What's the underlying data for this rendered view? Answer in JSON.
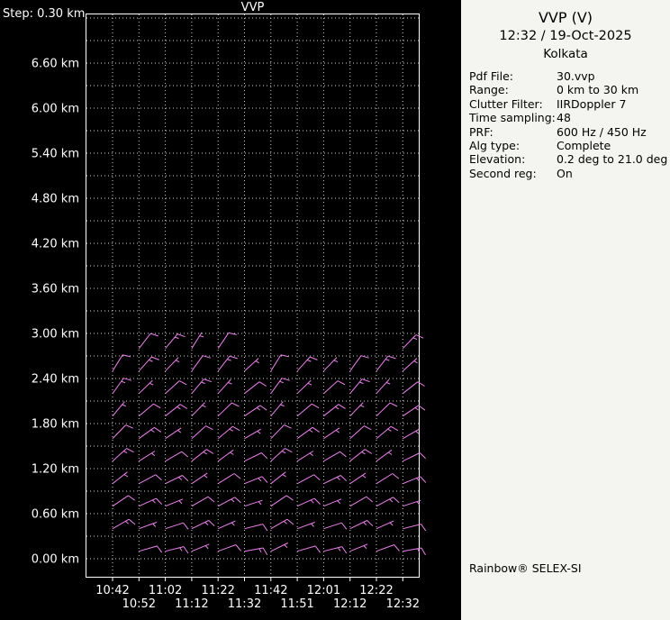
{
  "colors": {
    "background": "#000000",
    "panel_background": "#f4f4f0",
    "frame": "#ffffff",
    "grid": "#d0d0d0",
    "axis_text": "#ffffff",
    "barb": "#ee82ee",
    "panel_text": "#000000"
  },
  "chart": {
    "title": "VVP",
    "step_label": "Step: 0.30 km"
  },
  "info_panel": {
    "title": "VVP (V)",
    "datetime": "12:32 / 19-Oct-2025",
    "site": "Kolkata",
    "fields": [
      {
        "label": "Pdf File:",
        "value": "30.vvp"
      },
      {
        "label": "Range:",
        "value": "0 km to 30 km"
      },
      {
        "label": "Clutter Filter:",
        "value": "IIRDoppler 7"
      },
      {
        "label": "Time sampling:",
        "value": "48"
      },
      {
        "label": "PRF:",
        "value": "600 Hz / 450 Hz"
      },
      {
        "label": "Alg type:",
        "value": "Complete"
      },
      {
        "label": "Elevation:",
        "value": "0.2 deg to 21.0 deg"
      },
      {
        "label": "Second reg:",
        "value": "On"
      }
    ],
    "footer": "Rainbow® SELEX-SI"
  },
  "chart_data": {
    "type": "scatter",
    "glyph": "wind-barb",
    "title": "VVP",
    "x": [
      "10:42",
      "10:52",
      "11:02",
      "11:12",
      "11:22",
      "11:32",
      "11:42",
      "11:51",
      "12:01",
      "12:12",
      "12:22",
      "12:32"
    ],
    "y_unit": "km",
    "y_range_km": [
      0.0,
      7.2
    ],
    "y_step_km": 0.3,
    "y_ticks": [
      {
        "km": 6.6,
        "label": "6.60 km"
      },
      {
        "km": 6.0,
        "label": "6.00 km"
      },
      {
        "km": 5.4,
        "label": "5.40 km"
      },
      {
        "km": 4.8,
        "label": "4.80 km"
      },
      {
        "km": 4.2,
        "label": "4.20 km"
      },
      {
        "km": 3.6,
        "label": "3.60 km"
      },
      {
        "km": 3.0,
        "label": "3.00 km"
      },
      {
        "km": 2.4,
        "label": "2.40 km"
      },
      {
        "km": 1.8,
        "label": "1.80 km"
      },
      {
        "km": 1.2,
        "label": "1.20 km"
      },
      {
        "km": 0.6,
        "label": "0.60 km"
      },
      {
        "km": 0.0,
        "label": "0.00 km"
      }
    ],
    "units": {
      "direction": "deg",
      "speed": "kt"
    },
    "levels": [
      {
        "h": 0.1,
        "winds": [
          null,
          [
            74,
            10
          ],
          [
            76,
            15
          ],
          [
            68,
            5
          ],
          [
            70,
            10
          ],
          [
            80,
            15
          ],
          [
            64,
            5
          ],
          [
            74,
            10
          ],
          [
            76,
            15
          ],
          [
            68,
            5
          ],
          [
            70,
            10
          ],
          [
            80,
            15
          ]
        ]
      },
      {
        "h": 0.4,
        "winds": [
          [
            60,
            15
          ],
          [
            70,
            5
          ],
          [
            72,
            10
          ],
          [
            64,
            15
          ],
          [
            66,
            5
          ],
          [
            76,
            10
          ],
          [
            60,
            15
          ],
          [
            70,
            5
          ],
          [
            72,
            10
          ],
          [
            64,
            15
          ],
          [
            66,
            5
          ],
          [
            76,
            10
          ]
        ]
      },
      {
        "h": 0.7,
        "winds": [
          [
            56,
            10
          ],
          [
            66,
            15
          ],
          [
            68,
            5
          ],
          [
            60,
            10
          ],
          [
            62,
            15
          ],
          [
            72,
            5
          ],
          [
            56,
            10
          ],
          [
            66,
            15
          ],
          [
            68,
            5
          ],
          [
            60,
            10
          ],
          [
            62,
            15
          ],
          [
            72,
            5
          ]
        ]
      },
      {
        "h": 1.0,
        "winds": [
          [
            52,
            5
          ],
          [
            62,
            10
          ],
          [
            64,
            15
          ],
          [
            56,
            5
          ],
          [
            58,
            10
          ],
          [
            68,
            15
          ],
          [
            52,
            5
          ],
          [
            62,
            10
          ],
          [
            64,
            15
          ],
          [
            56,
            5
          ],
          [
            58,
            10
          ],
          [
            68,
            15
          ]
        ]
      },
      {
        "h": 1.3,
        "winds": [
          [
            48,
            15
          ],
          [
            58,
            5
          ],
          [
            60,
            10
          ],
          [
            52,
            15
          ],
          [
            54,
            5
          ],
          [
            64,
            10
          ],
          [
            48,
            15
          ],
          [
            58,
            5
          ],
          [
            60,
            10
          ],
          [
            52,
            15
          ],
          [
            54,
            5
          ],
          [
            64,
            10
          ]
        ]
      },
      {
        "h": 1.6,
        "winds": [
          [
            44,
            10
          ],
          [
            54,
            15
          ],
          [
            56,
            5
          ],
          [
            48,
            10
          ],
          [
            50,
            15
          ],
          [
            60,
            5
          ],
          [
            44,
            10
          ],
          [
            54,
            15
          ],
          [
            56,
            5
          ],
          [
            48,
            10
          ],
          [
            50,
            15
          ],
          [
            60,
            5
          ]
        ]
      },
      {
        "h": 1.9,
        "winds": [
          [
            40,
            5
          ],
          [
            50,
            10
          ],
          [
            52,
            15
          ],
          [
            44,
            5
          ],
          [
            46,
            10
          ],
          [
            56,
            15
          ],
          [
            40,
            5
          ],
          [
            50,
            10
          ],
          [
            52,
            15
          ],
          [
            44,
            5
          ],
          [
            46,
            10
          ],
          [
            56,
            15
          ]
        ]
      },
      {
        "h": 2.2,
        "winds": [
          [
            36,
            15
          ],
          [
            46,
            5
          ],
          [
            48,
            10
          ],
          [
            40,
            15
          ],
          [
            42,
            5
          ],
          [
            52,
            10
          ],
          [
            36,
            15
          ],
          [
            46,
            5
          ],
          [
            48,
            10
          ],
          [
            40,
            15
          ],
          [
            42,
            5
          ],
          [
            52,
            10
          ]
        ]
      },
      {
        "h": 2.5,
        "winds": [
          [
            32,
            10
          ],
          [
            42,
            15
          ],
          [
            44,
            5
          ],
          [
            36,
            10
          ],
          [
            38,
            15
          ],
          [
            48,
            5
          ],
          [
            32,
            10
          ],
          [
            42,
            15
          ],
          [
            44,
            5
          ],
          [
            36,
            10
          ],
          [
            38,
            15
          ],
          [
            48,
            5
          ]
        ]
      },
      {
        "h": 2.8,
        "winds": [
          null,
          [
            38,
            10
          ],
          [
            40,
            15
          ],
          [
            32,
            5
          ],
          [
            34,
            10
          ],
          null,
          null,
          null,
          null,
          null,
          null,
          [
            44,
            15
          ]
        ]
      }
    ]
  }
}
